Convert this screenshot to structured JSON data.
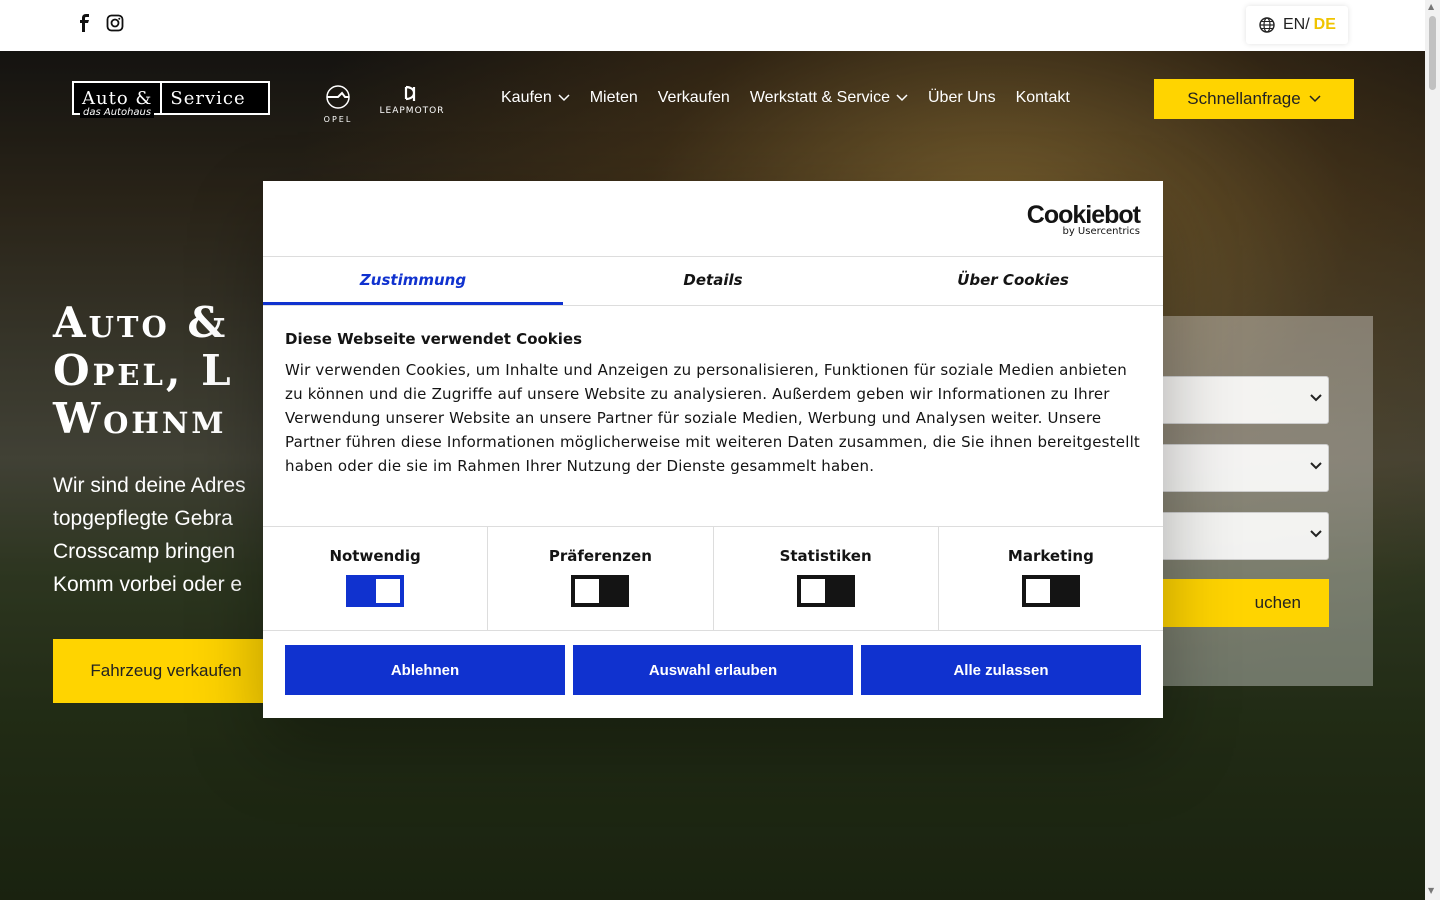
{
  "topbar": {
    "social": [
      {
        "icon": "facebook-icon"
      },
      {
        "icon": "instagram-icon"
      }
    ],
    "lang_en": "EN/",
    "lang_de": "DE"
  },
  "nav": {
    "logo_part1": "Auto &",
    "logo_part2": "Service",
    "logo_sub": "das Autohaus",
    "brand1": "OPEL",
    "brand2": "LEAPMOTOR",
    "items": [
      {
        "label": "Kaufen",
        "dropdown": true
      },
      {
        "label": "Mieten",
        "dropdown": false
      },
      {
        "label": "Verkaufen",
        "dropdown": false
      },
      {
        "label": "Werkstatt & Service",
        "dropdown": true
      },
      {
        "label": "Über Uns",
        "dropdown": false
      },
      {
        "label": "Kontakt",
        "dropdown": false
      }
    ],
    "quick_label": "Schnellanfrage"
  },
  "hero": {
    "title_line1": "Auto &",
    "title_line2": "Opel, L",
    "title_line3": "Wohnm",
    "text_line1": "Wir sind deine Adres",
    "text_line2": "topgepflegte Gebra",
    "text_line3": "Crosscamp bringen",
    "text_line4": "Komm vorbei oder e",
    "sell_button": "Fahrzeug verkaufen",
    "search_button": "uchen"
  },
  "cookie": {
    "brand": "Cookiebot",
    "brand_sub": "by Usercentrics",
    "tabs": [
      "Zustimmung",
      "Details",
      "Über Cookies"
    ],
    "heading": "Diese Webseite verwendet Cookies",
    "text": "Wir verwenden Cookies, um Inhalte und Anzeigen zu personalisieren, Funktionen für soziale Medien anbieten zu können und die Zugriffe auf unsere Website zu analysieren. Außerdem geben wir Informationen zu Ihrer Verwendung unserer Website an unsere Partner für soziale Medien, Werbung und Analysen weiter. Unsere Partner führen diese Informationen möglicherweise mit weiteren Daten zusammen, die Sie ihnen bereitgestellt haben oder die sie im Rahmen Ihrer Nutzung der Dienste gesammelt haben.",
    "toggles": [
      {
        "label": "Notwendig",
        "on": true
      },
      {
        "label": "Präferenzen",
        "on": false
      },
      {
        "label": "Statistiken",
        "on": false
      },
      {
        "label": "Marketing",
        "on": false
      }
    ],
    "buttons": [
      "Ablehnen",
      "Auswahl erlauben",
      "Alle zulassen"
    ]
  },
  "colors": {
    "accent": "#ffd400",
    "cookie_blue": "#1032cf"
  }
}
